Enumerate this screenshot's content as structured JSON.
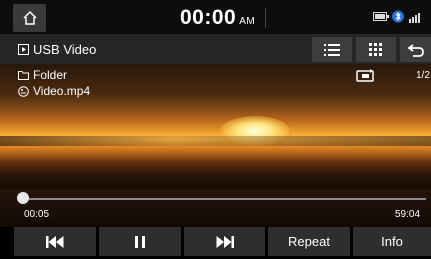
{
  "status_bar": {
    "time": "00:00",
    "ampm": "AM",
    "icons": [
      "home-icon",
      "battery-icon",
      "bluetooth-icon",
      "signal-icon"
    ]
  },
  "header": {
    "source_label": "USB Video",
    "buttons": [
      "list-icon",
      "grid-menu-icon",
      "back-icon"
    ]
  },
  "now_playing": {
    "folder": "Folder",
    "filename": "Video.mp4",
    "counter": "1/2",
    "repeat_icon": "repeat-folder-icon"
  },
  "progress": {
    "current_time": "00:05",
    "total_time": "59:04",
    "fraction": 0.0014
  },
  "controls": {
    "prev_icon": "skip-previous-icon",
    "pause_icon": "pause-icon",
    "next_icon": "skip-next-icon",
    "repeat_label": "Repeat",
    "info_label": "Info"
  }
}
